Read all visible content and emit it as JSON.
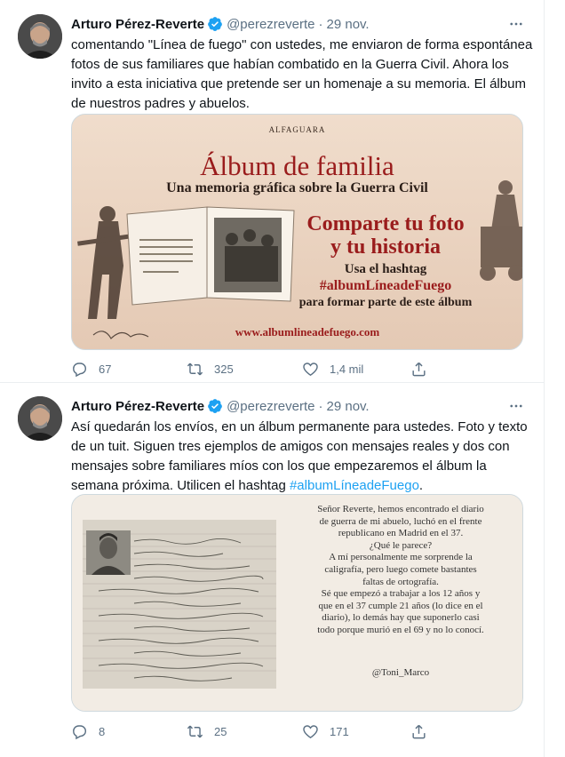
{
  "colors": {
    "accent": "#1da1f2",
    "secondary_text": "#5b7083",
    "primary_text": "#0f1419",
    "ad_red": "#9a1c1c"
  },
  "tweets": [
    {
      "author": {
        "name": "Arturo Pérez-Reverte",
        "handle": "@perezreverte",
        "verified": true
      },
      "date": "29 nov.",
      "text": "comentando \"Línea de fuego\" con ustedes, me enviaron de forma espontánea fotos de sus familiares que habían combatido en la Guerra Civil. Ahora los invito a esta iniciativa que pretende ser un homenaje a su memoria. El álbum de nuestros padres y abuelos.",
      "media": {
        "publisher": "ALFAGUARA",
        "title": "Álbum de familia",
        "subtitle": "Una memoria gráfica sobre la Guerra Civil",
        "cta": "Comparte tu foto\ny tu historia",
        "hashtag_label": "Usa el hashtag",
        "hashtag": "#albumLíneadeFuego",
        "join_text": "para formar parte de este álbum",
        "url": "www.albumlineadefuego.com"
      },
      "stats": {
        "replies": "67",
        "retweets": "325",
        "likes": "1,4 mil"
      }
    },
    {
      "author": {
        "name": "Arturo Pérez-Reverte",
        "handle": "@perezreverte",
        "verified": true
      },
      "date": "29 nov.",
      "text_main": "Así quedarán los envíos, en un álbum permanente para ustedes. Foto y texto de un tuit. Siguen tres ejemplos de amigos con mensajes reales y dos con mensajes sobre familiares míos con los que empezaremos el álbum la semana próxima. Utilicen el hashtag ",
      "hashtag": "#albumLíneadeFuego",
      "text_end": ".",
      "media": {
        "letter_text": "Señor Reverte, hemos encontrado el diario\nde guerra de mi abuelo, luchó en el frente\nrepublicano en Madrid en el 37.\n¿Qué le parece?\nA mí personalmente me sorprende la\ncaligrafía, pero luego comete bastantes\nfaltas de ortografía.\nSé que empezó a trabajar a los 12 años y\nque en el 37 cumple 21 años (lo dice en el\ndiario), lo demás hay que suponerlo casi\ntodo porque murió en el 69 y no lo conocí.",
        "signature": "@Toni_Marco"
      },
      "stats": {
        "replies": "8",
        "retweets": "25",
        "likes": "171"
      }
    }
  ],
  "icons": {
    "verified": "verified-badge-icon",
    "more": "more-dots-icon",
    "reply": "reply-icon",
    "retweet": "retweet-icon",
    "like": "heart-icon",
    "share": "share-icon"
  }
}
